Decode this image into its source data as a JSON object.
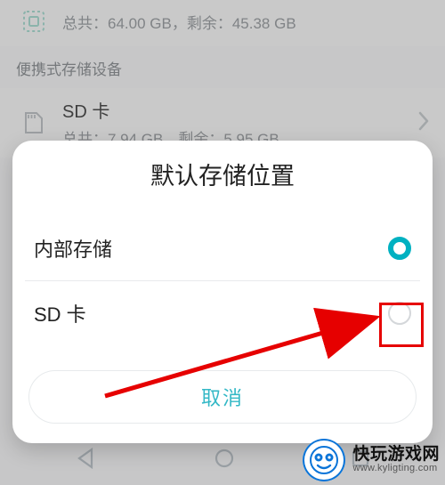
{
  "bg": {
    "internal": {
      "sub_total_label": "总共：",
      "sub_total_value": "64.00 GB",
      "sub_sep": "，",
      "sub_free_label": "剩余：",
      "sub_free_value": "45.38 GB"
    },
    "section_label": "便携式存储设备",
    "sd": {
      "name": "SD 卡",
      "sub_total_label": "总共：",
      "sub_total_value": "7.94 GB",
      "sub_sep": "，",
      "sub_free_label": "剩余：",
      "sub_free_value": "5.95 GB"
    }
  },
  "dialog": {
    "title": "默认存储位置",
    "option_internal": "内部存储",
    "option_sdcard": "SD 卡",
    "selected": "internal",
    "cancel": "取消"
  },
  "brand": {
    "title": "快玩游戏网",
    "url": "www.kyligting.com"
  }
}
